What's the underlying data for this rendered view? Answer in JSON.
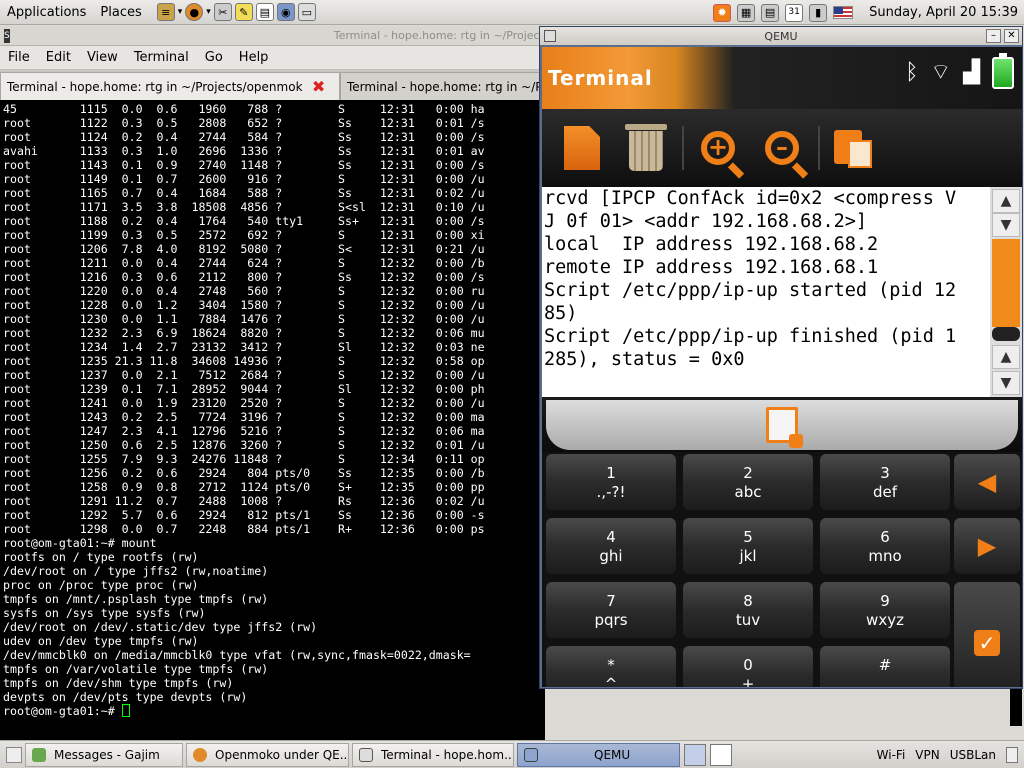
{
  "top_panel": {
    "applications": "Applications",
    "places": "Places",
    "calendar_day": "31",
    "clock": "Sunday, April 20 15:39"
  },
  "terminal": {
    "window_title": "Terminal - hope.home: rtg in ~/Projects/op",
    "menu": [
      "File",
      "Edit",
      "View",
      "Terminal",
      "Go",
      "Help"
    ],
    "tabs": [
      "Terminal - hope.home: rtg in ~/Projects/openmok",
      "Terminal - hope.home: rtg in ~/Projects/o"
    ],
    "lines": [
      "45         1115  0.0  0.6   1960   788 ?        S     12:31   0:00 ha",
      "root       1122  0.3  0.5   2808   652 ?        Ss    12:31   0:01 /s",
      "root       1124  0.2  0.4   2744   584 ?        Ss    12:31   0:00 /s",
      "avahi      1133  0.3  1.0   2696  1336 ?        Ss    12:31   0:01 av",
      "root       1143  0.1  0.9   2740  1148 ?        Ss    12:31   0:00 /s",
      "root       1149  0.1  0.7   2600   916 ?        S     12:31   0:00 /u",
      "root       1165  0.7  0.4   1684   588 ?        Ss    12:31   0:02 /u",
      "root       1171  3.5  3.8  18508  4856 ?        S<sl  12:31   0:10 /u",
      "root       1188  0.2  0.4   1764   540 tty1     Ss+   12:31   0:00 /s",
      "root       1199  0.3  0.5   2572   692 ?        S     12:31   0:00 xi",
      "root       1206  7.8  4.0   8192  5080 ?        S<    12:31   0:21 /u",
      "root       1211  0.0  0.4   2744   624 ?        S     12:32   0:00 /b",
      "root       1216  0.3  0.6   2112   800 ?        Ss    12:32   0:00 /s",
      "root       1220  0.0  0.4   2748   560 ?        S     12:32   0:00 ru",
      "root       1228  0.0  1.2   3404  1580 ?        S     12:32   0:00 /u",
      "root       1230  0.0  1.1   7884  1476 ?        S     12:32   0:00 /u",
      "root       1232  2.3  6.9  18624  8820 ?        S     12:32   0:06 mu",
      "root       1234  1.4  2.7  23132  3412 ?        Sl    12:32   0:03 ne",
      "root       1235 21.3 11.8  34608 14936 ?        S     12:32   0:58 op",
      "root       1237  0.0  2.1   7512  2684 ?        S     12:32   0:00 /u",
      "root       1239  0.1  7.1  28952  9044 ?        Sl    12:32   0:00 ph",
      "root       1241  0.0  1.9  23120  2520 ?        S     12:32   0:00 /u",
      "root       1243  0.2  2.5   7724  3196 ?        S     12:32   0:00 ma",
      "root       1247  2.3  4.1  12796  5216 ?        S     12:32   0:06 ma",
      "root       1250  0.6  2.5  12876  3260 ?        S     12:32   0:01 /u",
      "root       1255  7.9  9.3  24276 11848 ?        S     12:34   0:11 op",
      "root       1256  0.2  0.6   2924   804 pts/0    Ss    12:35   0:00 /b",
      "root       1258  0.9  0.8   2712  1124 pts/0    S+    12:35   0:00 pp",
      "root       1291 11.2  0.7   2488  1008 ?        Rs    12:36   0:02 /u",
      "root       1292  5.7  0.6   2924   812 pts/1    Ss    12:36   0:00 -s",
      "root       1298  0.0  0.7   2248   884 pts/1    R+    12:36   0:00 ps",
      "root@om-gta01:~# mount",
      "rootfs on / type rootfs (rw)",
      "/dev/root on / type jffs2 (rw,noatime)",
      "proc on /proc type proc (rw)",
      "tmpfs on /mnt/.psplash type tmpfs (rw)",
      "sysfs on /sys type sysfs (rw)",
      "/dev/root on /dev/.static/dev type jffs2 (rw)",
      "udev on /dev type tmpfs (rw)",
      "/dev/mmcblk0 on /media/mmcblk0 type vfat (rw,sync,fmask=0022,dmask=",
      "tmpfs on /var/volatile type tmpfs (rw)",
      "tmpfs on /dev/shm type tmpfs (rw)",
      "devpts on /dev/pts type devpts (rw)"
    ],
    "prompt": "root@om-gta01:~# "
  },
  "qemu": {
    "title": "QEMU",
    "app_title": "Terminal",
    "text_lines": [
      "rcvd [IPCP ConfAck id=0x2 <compress V",
      "J 0f 01> <addr 192.168.68.2>]",
      "local  IP address 192.168.68.2",
      "remote IP address 192.168.68.1",
      "Script /etc/ppp/ip-up started (pid 12",
      "85)",
      "Script /etc/ppp/ip-up finished (pid 1",
      "285), status = 0x0"
    ],
    "keys": [
      {
        "d": "1",
        "l": ".,-?!"
      },
      {
        "d": "2",
        "l": "abc"
      },
      {
        "d": "3",
        "l": "def"
      },
      {
        "d": "4",
        "l": "ghi"
      },
      {
        "d": "5",
        "l": "jkl"
      },
      {
        "d": "6",
        "l": "mno"
      },
      {
        "d": "7",
        "l": "pqrs"
      },
      {
        "d": "8",
        "l": "tuv"
      },
      {
        "d": "9",
        "l": "wxyz"
      },
      {
        "d": "*",
        "l": "^"
      },
      {
        "d": "0",
        "l": "+"
      },
      {
        "d": "#",
        "l": "_"
      }
    ],
    "accent": "#f07f18"
  },
  "taskbar": {
    "tasks": [
      "Messages - Gajim",
      "Openmoko under QE...",
      "Terminal - hope.hom...",
      "QEMU"
    ],
    "tray": [
      "Wi-Fi",
      "VPN",
      "USBLan"
    ]
  }
}
